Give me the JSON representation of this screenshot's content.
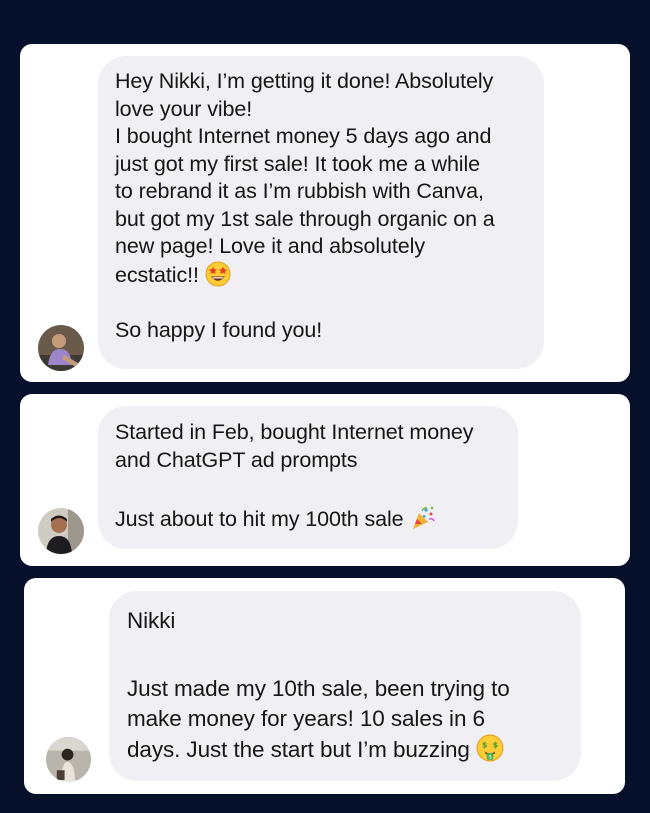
{
  "testimonials": [
    {
      "lines_a": [
        "Hey Nikki, I’m getting it done! Absolutely",
        "love your vibe!",
        "I bought Internet money 5 days ago and",
        "just got my first sale! It took me a while",
        "to rebrand it as I’m rubbish with Canva,",
        "but got my 1st sale through organic on a",
        "new page! Love it and absolutely"
      ],
      "line_b": "ecstatic!!",
      "emoji": "star-struck-emoji",
      "line_c": "So happy I found you!"
    },
    {
      "lines_a": [
        "Started in Feb, bought Internet money",
        "and ChatGPT ad prompts"
      ],
      "line_b": "Just about to hit my 100th sale",
      "emoji": "party-popper-emoji"
    },
    {
      "line_title": "Nikki",
      "lines_a": [
        "Just made my 10th sale, been trying to",
        "make money for years! 10 sales in 6"
      ],
      "line_b": "days. Just the start but I’m buzzing",
      "emoji": "money-mouth-emoji"
    }
  ],
  "colors": {
    "background": "#07102a",
    "card": "#ffffff",
    "bubble": "#efeff4",
    "text": "#161616"
  }
}
